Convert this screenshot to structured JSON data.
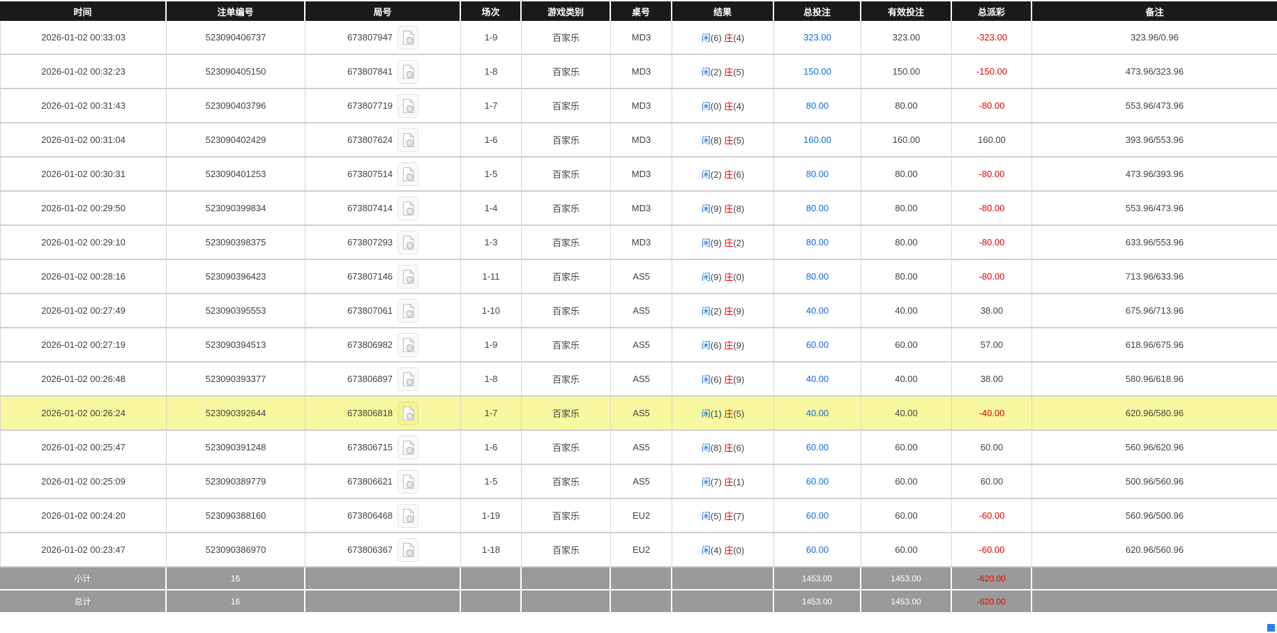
{
  "colors": {
    "header_bg": "#1a1a1a",
    "header_text": "#ffffff",
    "row_border": "#cfcfcf",
    "highlight_row_bg": "#f8f8a0",
    "footer_bg": "#9a9a9a",
    "link_blue": "#0d6bdb",
    "player_blue": "#0d6bdb",
    "banker_red": "#e60000",
    "negative_red": "#e60000",
    "corner_badge_blue": "#2f7ced"
  },
  "icons": {
    "round_replay": "video-file-icon"
  },
  "table": {
    "columns": [
      {
        "key": "time",
        "label": "时间"
      },
      {
        "key": "bet_id",
        "label": "注单编号"
      },
      {
        "key": "round_id",
        "label": "局号"
      },
      {
        "key": "session",
        "label": "场次"
      },
      {
        "key": "game_type",
        "label": "游戏类别"
      },
      {
        "key": "table_id",
        "label": "桌号"
      },
      {
        "key": "result",
        "label": "结果"
      },
      {
        "key": "total_bet",
        "label": "总投注"
      },
      {
        "key": "valid_bet",
        "label": "有效投注"
      },
      {
        "key": "payout",
        "label": "总派彩"
      },
      {
        "key": "remark",
        "label": "备注"
      }
    ],
    "rows": [
      {
        "time": "2026-01-02 00:33:03",
        "bet_id": "523090406737",
        "round_id": "673807947",
        "session": "1-9",
        "game_type": "百家乐",
        "table_id": "MD3",
        "p": "闲",
        "pn": "(6)",
        "b": "庄",
        "bn": "(4)",
        "total_bet": "323.00",
        "valid_bet": "323.00",
        "payout": "-323.00",
        "remark": "323.96/0.96"
      },
      {
        "time": "2026-01-02 00:32:23",
        "bet_id": "523090405150",
        "round_id": "673807841",
        "session": "1-8",
        "game_type": "百家乐",
        "table_id": "MD3",
        "p": "闲",
        "pn": "(2)",
        "b": "庄",
        "bn": "(5)",
        "total_bet": "150.00",
        "valid_bet": "150.00",
        "payout": "-150.00",
        "remark": "473.96/323.96"
      },
      {
        "time": "2026-01-02 00:31:43",
        "bet_id": "523090403796",
        "round_id": "673807719",
        "session": "1-7",
        "game_type": "百家乐",
        "table_id": "MD3",
        "p": "闲",
        "pn": "(0)",
        "b": "庄",
        "bn": "(4)",
        "total_bet": "80.00",
        "valid_bet": "80.00",
        "payout": "-80.00",
        "remark": "553.96/473.96"
      },
      {
        "time": "2026-01-02 00:31:04",
        "bet_id": "523090402429",
        "round_id": "673807624",
        "session": "1-6",
        "game_type": "百家乐",
        "table_id": "MD3",
        "p": "闲",
        "pn": "(8)",
        "b": "庄",
        "bn": "(5)",
        "total_bet": "160.00",
        "valid_bet": "160.00",
        "payout": "160.00",
        "remark": "393.96/553.96"
      },
      {
        "time": "2026-01-02 00:30:31",
        "bet_id": "523090401253",
        "round_id": "673807514",
        "session": "1-5",
        "game_type": "百家乐",
        "table_id": "MD3",
        "p": "闲",
        "pn": "(2)",
        "b": "庄",
        "bn": "(6)",
        "total_bet": "80.00",
        "valid_bet": "80.00",
        "payout": "-80.00",
        "remark": "473.96/393.96"
      },
      {
        "time": "2026-01-02 00:29:50",
        "bet_id": "523090399834",
        "round_id": "673807414",
        "session": "1-4",
        "game_type": "百家乐",
        "table_id": "MD3",
        "p": "闲",
        "pn": "(9)",
        "b": "庄",
        "bn": "(8)",
        "total_bet": "80.00",
        "valid_bet": "80.00",
        "payout": "-80.00",
        "remark": "553.96/473.96"
      },
      {
        "time": "2026-01-02 00:29:10",
        "bet_id": "523090398375",
        "round_id": "673807293",
        "session": "1-3",
        "game_type": "百家乐",
        "table_id": "MD3",
        "p": "闲",
        "pn": "(9)",
        "b": "庄",
        "bn": "(2)",
        "total_bet": "80.00",
        "valid_bet": "80.00",
        "payout": "-80.00",
        "remark": "633.96/553.96"
      },
      {
        "time": "2026-01-02 00:28:16",
        "bet_id": "523090396423",
        "round_id": "673807146",
        "session": "1-11",
        "game_type": "百家乐",
        "table_id": "AS5",
        "p": "闲",
        "pn": "(9)",
        "b": "庄",
        "bn": "(0)",
        "total_bet": "80.00",
        "valid_bet": "80.00",
        "payout": "-80.00",
        "remark": "713.96/633.96"
      },
      {
        "time": "2026-01-02 00:27:49",
        "bet_id": "523090395553",
        "round_id": "673807061",
        "session": "1-10",
        "game_type": "百家乐",
        "table_id": "AS5",
        "p": "闲",
        "pn": "(2)",
        "b": "庄",
        "bn": "(9)",
        "total_bet": "40.00",
        "valid_bet": "40.00",
        "payout": "38.00",
        "remark": "675.96/713.96"
      },
      {
        "time": "2026-01-02 00:27:19",
        "bet_id": "523090394513",
        "round_id": "673806982",
        "session": "1-9",
        "game_type": "百家乐",
        "table_id": "AS5",
        "p": "闲",
        "pn": "(6)",
        "b": "庄",
        "bn": "(9)",
        "total_bet": "60.00",
        "valid_bet": "60.00",
        "payout": "57.00",
        "remark": "618.96/675.96"
      },
      {
        "time": "2026-01-02 00:26:48",
        "bet_id": "523090393377",
        "round_id": "673806897",
        "session": "1-8",
        "game_type": "百家乐",
        "table_id": "AS5",
        "p": "闲",
        "pn": "(6)",
        "b": "庄",
        "bn": "(9)",
        "total_bet": "40.00",
        "valid_bet": "40.00",
        "payout": "38.00",
        "remark": "580.96/618.96"
      },
      {
        "time": "2026-01-02 00:26:24",
        "bet_id": "523090392644",
        "round_id": "673806818",
        "session": "1-7",
        "game_type": "百家乐",
        "table_id": "AS5",
        "p": "闲",
        "pn": "(1)",
        "b": "庄",
        "bn": "(5)",
        "total_bet": "40.00",
        "valid_bet": "40.00",
        "payout": "-40.00",
        "remark": "620.96/580.96",
        "highlighted": true
      },
      {
        "time": "2026-01-02 00:25:47",
        "bet_id": "523090391248",
        "round_id": "673806715",
        "session": "1-6",
        "game_type": "百家乐",
        "table_id": "AS5",
        "p": "闲",
        "pn": "(8)",
        "b": "庄",
        "bn": "(6)",
        "total_bet": "60.00",
        "valid_bet": "60.00",
        "payout": "60.00",
        "remark": "560.96/620.96"
      },
      {
        "time": "2026-01-02 00:25:09",
        "bet_id": "523090389779",
        "round_id": "673806621",
        "session": "1-5",
        "game_type": "百家乐",
        "table_id": "AS5",
        "p": "闲",
        "pn": "(7)",
        "b": "庄",
        "bn": "(1)",
        "total_bet": "60.00",
        "valid_bet": "60.00",
        "payout": "60.00",
        "remark": "500.96/560.96"
      },
      {
        "time": "2026-01-02 00:24:20",
        "bet_id": "523090388160",
        "round_id": "673806468",
        "session": "1-19",
        "game_type": "百家乐",
        "table_id": "EU2",
        "p": "闲",
        "pn": "(5)",
        "b": "庄",
        "bn": "(7)",
        "total_bet": "60.00",
        "valid_bet": "60.00",
        "payout": "-60.00",
        "remark": "560.96/500.96"
      },
      {
        "time": "2026-01-02 00:23:47",
        "bet_id": "523090386970",
        "round_id": "673806367",
        "session": "1-18",
        "game_type": "百家乐",
        "table_id": "EU2",
        "p": "闲",
        "pn": "(4)",
        "b": "庄",
        "bn": "(0)",
        "total_bet": "60.00",
        "valid_bet": "60.00",
        "payout": "-60.00",
        "remark": "620.96/560.96"
      }
    ],
    "footer_rows": [
      {
        "label": "小计",
        "count": "16",
        "total_bet": "1453.00",
        "valid_bet": "1453.00",
        "payout": "-620.00"
      },
      {
        "label": "总计",
        "count": "16",
        "total_bet": "1453.00",
        "valid_bet": "1453.00",
        "payout": "-620.00"
      }
    ]
  }
}
